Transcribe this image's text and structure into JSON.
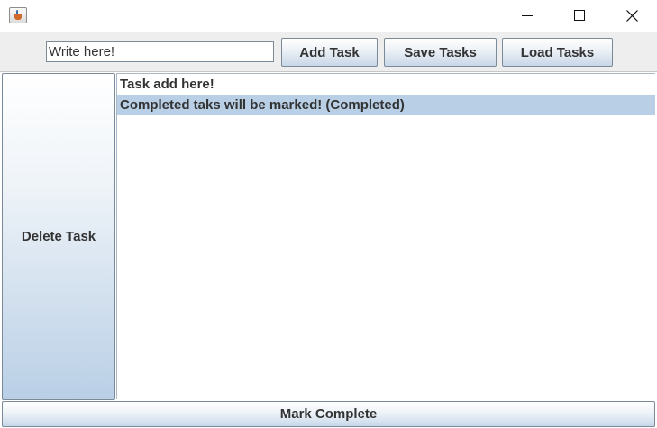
{
  "titlebar": {
    "icon": "java-cup-icon",
    "controls": [
      "minimize-icon",
      "maximize-icon",
      "close-icon"
    ]
  },
  "toolbar": {
    "input_value": "Write here!",
    "add_label": "Add Task",
    "save_label": "Save Tasks",
    "load_label": "Load Tasks"
  },
  "side": {
    "delete_label": "Delete Task"
  },
  "tasks": [
    {
      "text": "Task add here!",
      "selected": false
    },
    {
      "text": "Completed taks will be marked! (Completed)",
      "selected": true
    }
  ],
  "bottom": {
    "mark_label": "Mark Complete"
  },
  "colors": {
    "selection": "#b8cfe5",
    "button_border": "#7a8a99",
    "panel_bg": "#eeeeee"
  }
}
